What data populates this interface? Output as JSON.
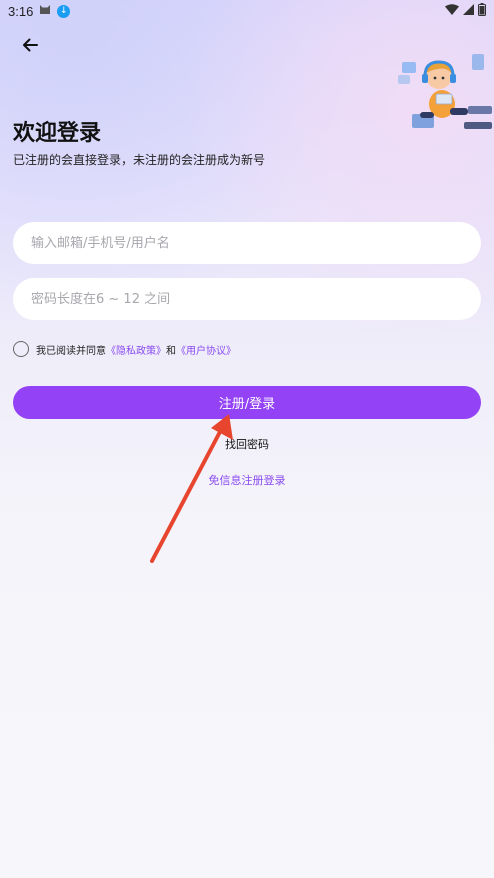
{
  "status_bar": {
    "time": "3:16",
    "icons": [
      "cat-icon",
      "download-icon",
      "wifi-icon",
      "signal-icon",
      "battery-icon"
    ]
  },
  "header": {
    "back_icon": "arrow-left-icon",
    "title": "欢迎登录",
    "subtitle": "已注册的会直接登录，未注册的会注册成为新号"
  },
  "form": {
    "account_placeholder": "输入邮箱/手机号/用户名",
    "account_value": "",
    "password_placeholder": "密码长度在6 ~ 12 之间",
    "password_value": ""
  },
  "agreement": {
    "prefix": "我已阅读并同意",
    "privacy_link": "《隐私政策》",
    "connector": "和",
    "user_link": "《用户协议》",
    "checked": false
  },
  "actions": {
    "submit_label": "注册/登录",
    "forgot_label": "找回密码",
    "sms_login_label": "免信息注册登录"
  },
  "colors": {
    "accent": "#9342f5",
    "link": "#8a4cf0",
    "annotation_arrow": "#e8452f"
  }
}
